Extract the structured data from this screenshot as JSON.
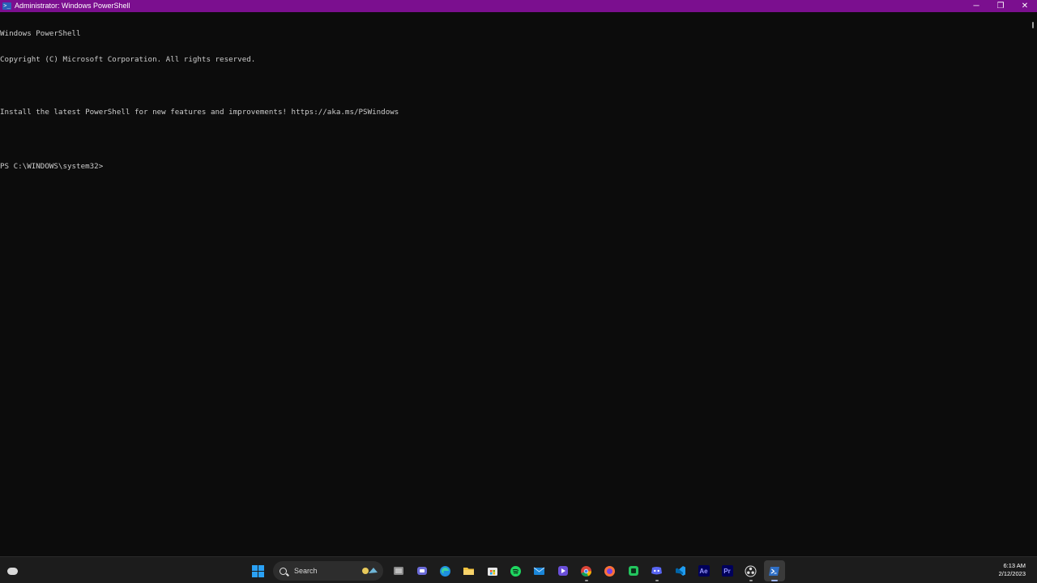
{
  "window": {
    "title": "Administrator: Windows PowerShell",
    "icon": "powershell-icon",
    "controls": {
      "minimize": "─",
      "maximize": "❐",
      "close": "✕"
    },
    "titlebar_color": "#7b0f8f"
  },
  "console": {
    "lines": [
      "Windows PowerShell",
      "Copyright (C) Microsoft Corporation. All rights reserved.",
      "",
      "Install the latest PowerShell for new features and improvements! https://aka.ms/PSWindows",
      "",
      "PS C:\\WINDOWS\\system32>"
    ],
    "background": "#0c0c0c",
    "foreground": "#cccccc"
  },
  "taskbar": {
    "search_label": "Search",
    "apps": [
      {
        "name": "task-view-icon",
        "label": ""
      },
      {
        "name": "teams-chat-icon",
        "label": ""
      },
      {
        "name": "edge-icon",
        "label": ""
      },
      {
        "name": "file-explorer-icon",
        "label": ""
      },
      {
        "name": "microsoft-store-icon",
        "label": ""
      },
      {
        "name": "spotify-icon",
        "label": ""
      },
      {
        "name": "mail-icon",
        "label": ""
      },
      {
        "name": "media-player-icon",
        "label": ""
      },
      {
        "name": "chrome-icon",
        "label": ""
      },
      {
        "name": "firefox-icon",
        "label": ""
      },
      {
        "name": "green-app-icon",
        "label": ""
      },
      {
        "name": "discord-icon",
        "label": ""
      },
      {
        "name": "vscode-icon",
        "label": ""
      },
      {
        "name": "after-effects-icon",
        "label": "Ae"
      },
      {
        "name": "premiere-pro-icon",
        "label": "Pr"
      },
      {
        "name": "obs-icon",
        "label": ""
      },
      {
        "name": "powershell-taskbar-icon",
        "label": ""
      }
    ],
    "clock": {
      "time": "6:13 AM",
      "date": "2/12/2023"
    },
    "accent": "#2aa1f5"
  }
}
